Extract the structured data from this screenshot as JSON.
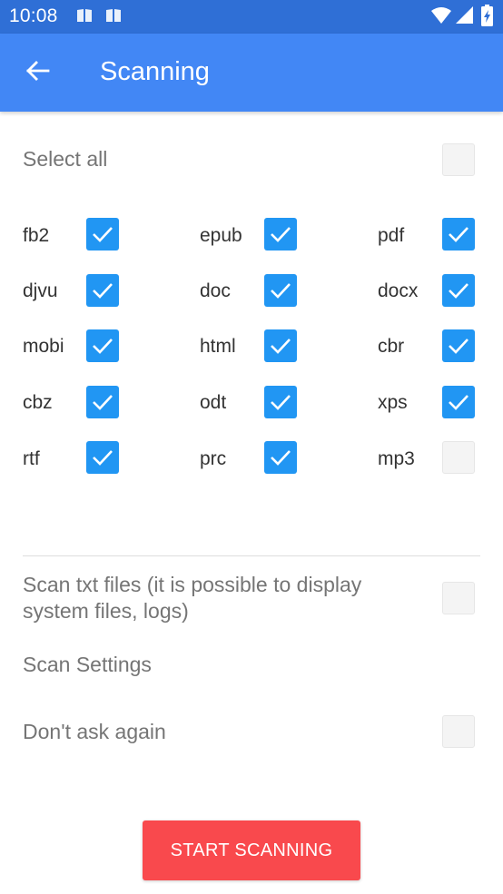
{
  "status_bar": {
    "time": "10:08",
    "icons": [
      "book-icon",
      "book-icon",
      "wifi-icon",
      "signal-icon",
      "battery-charging-icon"
    ],
    "background": "#2f6fd6"
  },
  "app_bar": {
    "title": "Scanning",
    "back_icon": "arrow-left-icon",
    "background": "#4287f5"
  },
  "select_all": {
    "label": "Select all",
    "checked": false
  },
  "file_types": [
    {
      "ext": "fb2",
      "checked": true
    },
    {
      "ext": "epub",
      "checked": true
    },
    {
      "ext": "pdf",
      "checked": true
    },
    {
      "ext": "djvu",
      "checked": true
    },
    {
      "ext": "doc",
      "checked": true
    },
    {
      "ext": "docx",
      "checked": true
    },
    {
      "ext": "mobi",
      "checked": true
    },
    {
      "ext": "html",
      "checked": true
    },
    {
      "ext": "cbr",
      "checked": true
    },
    {
      "ext": "cbz",
      "checked": true
    },
    {
      "ext": "odt",
      "checked": true
    },
    {
      "ext": "xps",
      "checked": true
    },
    {
      "ext": "rtf",
      "checked": true
    },
    {
      "ext": "prc",
      "checked": true
    },
    {
      "ext": "mp3",
      "checked": false
    }
  ],
  "options": {
    "scan_txt": {
      "label": "Scan txt files (it is possible to display system files, logs)",
      "checked": false
    },
    "scan_settings": {
      "label": "Scan Settings"
    },
    "dont_ask": {
      "label": "Don't ask again",
      "checked": false
    }
  },
  "start_button": {
    "label": "START SCANNING",
    "background": "#f9494d"
  },
  "colors": {
    "checkbox_checked": "#2196f3",
    "checkbox_unchecked": "#f4f4f4"
  }
}
